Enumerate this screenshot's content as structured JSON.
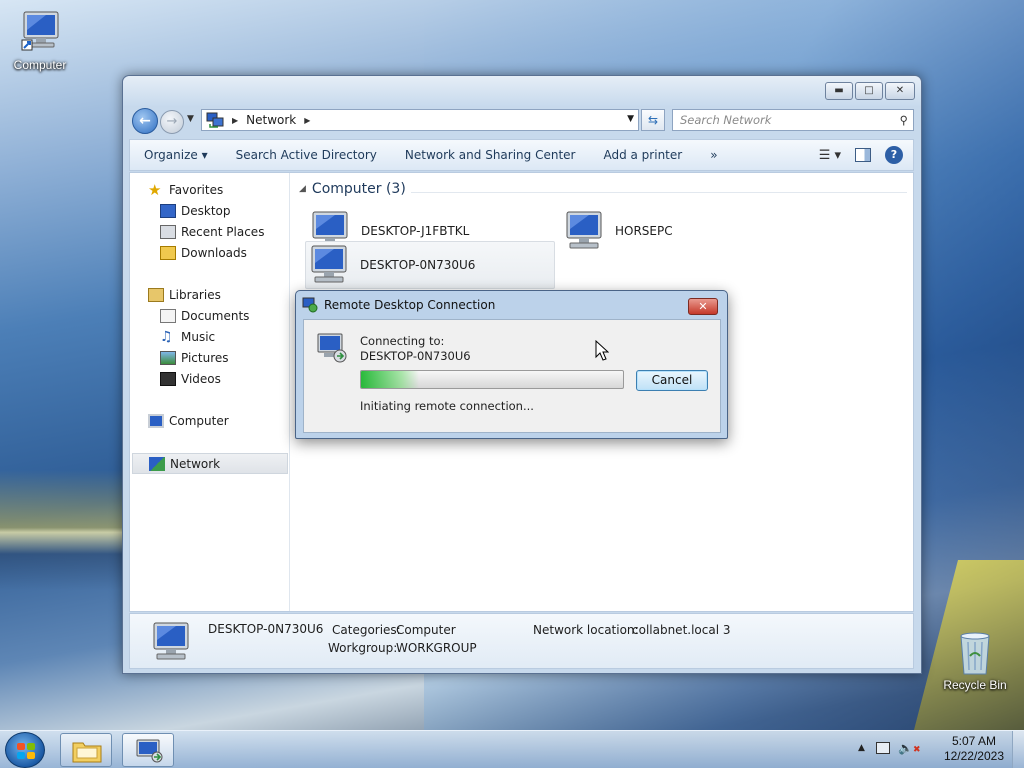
{
  "desktop": {
    "icons": [
      {
        "label": "Computer"
      },
      {
        "label": "Recycle Bin"
      }
    ]
  },
  "explorer": {
    "address": {
      "crumb": "Network",
      "search_placeholder": "Search Network"
    },
    "toolbar": {
      "organize": "Organize ▾",
      "search_ad": "Search Active Directory",
      "network_sharing": "Network and Sharing Center",
      "add_printer": "Add a printer",
      "more": "»"
    },
    "nav": {
      "favorites": "Favorites",
      "desktop": "Desktop",
      "recent": "Recent Places",
      "downloads": "Downloads",
      "libraries": "Libraries",
      "documents": "Documents",
      "music": "Music",
      "pictures": "Pictures",
      "videos": "Videos",
      "computer": "Computer",
      "network": "Network"
    },
    "group": {
      "title": "Computer (3)"
    },
    "computers": [
      {
        "name": "DESKTOP-J1FBTKL"
      },
      {
        "name": "HORSEPC"
      },
      {
        "name": "DESKTOP-0N730U6"
      }
    ],
    "details": {
      "name": "DESKTOP-0N730U6",
      "categories_label": "Categories:",
      "categories_value": "Computer",
      "workgroup_label": "Workgroup:",
      "workgroup_value": "WORKGROUP",
      "location_label": "Network location:",
      "location_value": "collabnet.local  3"
    }
  },
  "rdp_dialog": {
    "title": "Remote Desktop Connection",
    "connecting_label": "Connecting to:",
    "target": "DESKTOP-0N730U6",
    "status": "Initiating remote connection...",
    "cancel_label": "Cancel",
    "progress_fraction": 0.22
  },
  "taskbar": {
    "time": "5:07 AM",
    "date": "12/22/2023"
  },
  "colors": {
    "accent": "#2f6fc2",
    "progress_green": "#14b428",
    "close_red": "#c5392a"
  }
}
